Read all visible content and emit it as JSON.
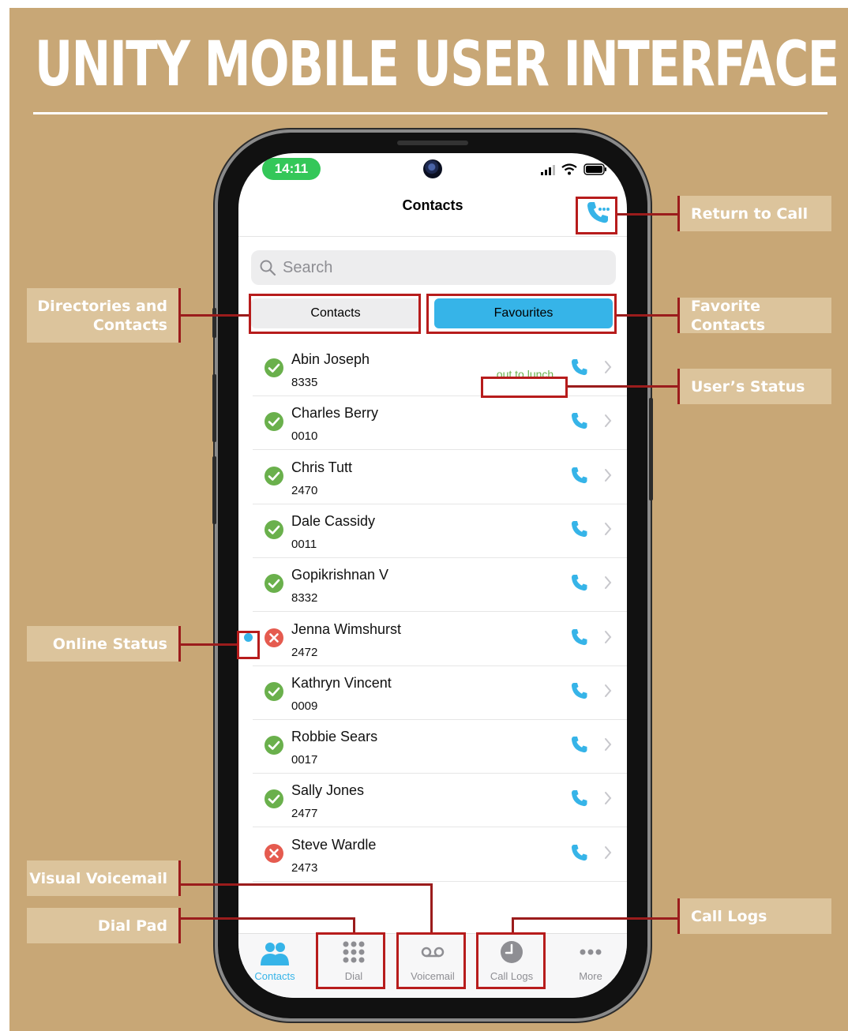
{
  "poster": {
    "title": "UNITY MOBILE USER INTERFACE"
  },
  "callouts": {
    "return_to_call": "Return to Call",
    "directories_line1": "Directories and",
    "directories_line2": "Contacts",
    "favorite_contacts": "Favorite Contacts",
    "users_status": "User’s Status",
    "online_status": "Online Status",
    "visual_voicemail": "Visual Voicemail",
    "dial_pad": "Dial Pad",
    "call_logs": "Call Logs"
  },
  "status_bar": {
    "time": "14:11",
    "icons": [
      "cellular-signal-icon",
      "wifi-icon",
      "battery-icon"
    ]
  },
  "nav": {
    "title": "Contacts",
    "return_icon": "phone-return-call-icon"
  },
  "search": {
    "placeholder": "Search",
    "value": ""
  },
  "segments": {
    "contacts": "Contacts",
    "favourites": "Favourites",
    "selected": "Favourites"
  },
  "contacts": [
    {
      "name": "Abin Joseph",
      "ext": "8335",
      "status": "available",
      "note": "out to lunch"
    },
    {
      "name": "Charles Berry",
      "ext": "0010",
      "status": "available"
    },
    {
      "name": "Chris Tutt",
      "ext": "2470",
      "status": "available"
    },
    {
      "name": "Dale Cassidy",
      "ext": "0011",
      "status": "available"
    },
    {
      "name": "Gopikrishnan V",
      "ext": "8332",
      "status": "available"
    },
    {
      "name": "Jenna Wimshurst",
      "ext": "2472",
      "status": "busy",
      "online_dot": true
    },
    {
      "name": "Kathryn Vincent",
      "ext": "0009",
      "status": "available"
    },
    {
      "name": "Robbie Sears",
      "ext": "0017",
      "status": "available"
    },
    {
      "name": "Sally Jones",
      "ext": "2477",
      "status": "available"
    },
    {
      "name": "Steve Wardle",
      "ext": "2473",
      "status": "busy"
    }
  ],
  "tabbar": {
    "contacts": "Contacts",
    "dial": "Dial",
    "voicemail": "Voicemail",
    "call_logs": "Call Logs",
    "more": "More",
    "active": "Contacts"
  },
  "colors": {
    "poster_bg": "#c8a776",
    "callout_bg": "#dcc49c",
    "callout_line": "#9b1c1c",
    "accent_blue": "#36b4e8",
    "available_green": "#6ab04c",
    "busy_red": "#e55b4f",
    "time_pill_green": "#34c759"
  }
}
